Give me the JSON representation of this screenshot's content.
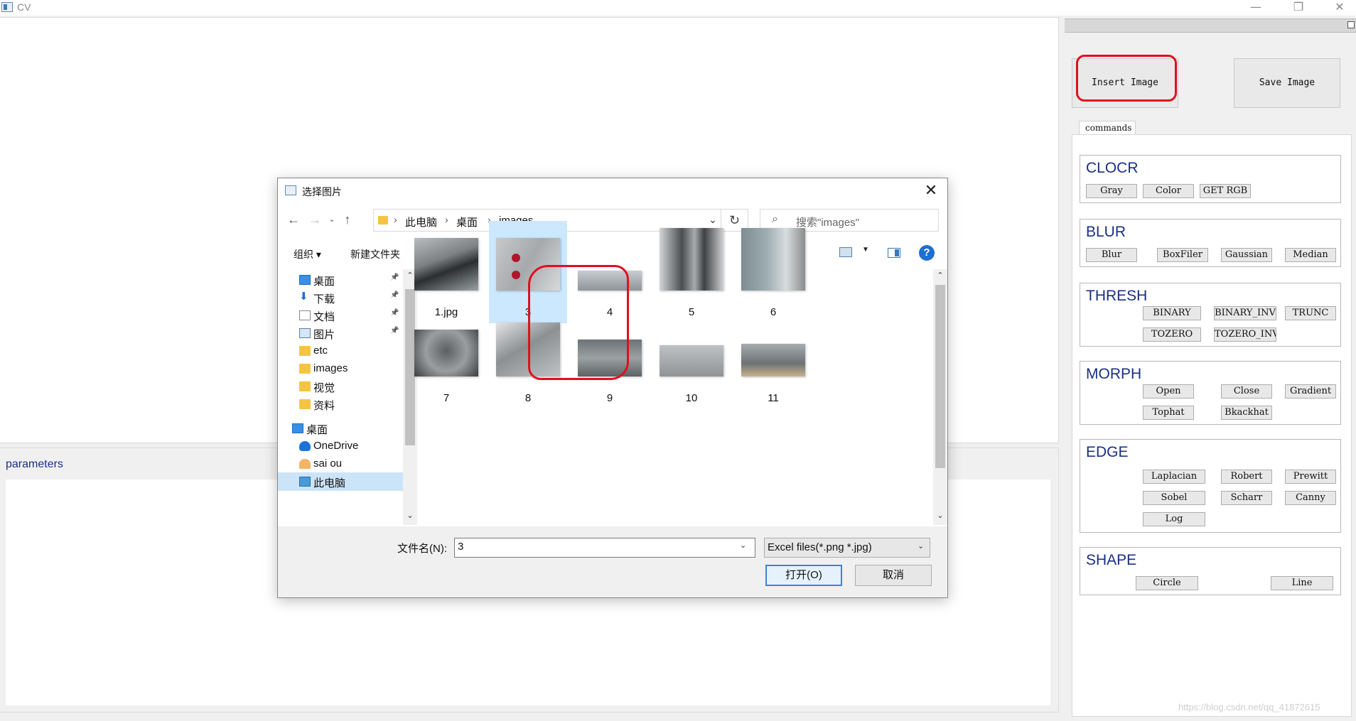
{
  "window": {
    "title": "CV",
    "controls": {
      "minimize": "—",
      "maximize": "❐",
      "close": "✕"
    }
  },
  "params_panel": {
    "title": "parameters"
  },
  "right_panel": {
    "insert_label": "Insert Image",
    "save_label": "Save Image",
    "commands_tab": "commands",
    "groups": [
      {
        "title": "CLOCR",
        "buttons": [
          "Gray",
          "Color",
          "GET RGB"
        ]
      },
      {
        "title": "BLUR",
        "buttons": [
          "Blur",
          "BoxFiler",
          "Gaussian",
          "Median"
        ]
      },
      {
        "title": "THRESH",
        "buttons": [
          "BINARY",
          "BINARY_INV",
          "TRUNC",
          "TOZERO",
          "TOZERO_INV"
        ]
      },
      {
        "title": "MORPH",
        "buttons": [
          "Open",
          "Close",
          "Gradient",
          "Tophat",
          "Bkackhat"
        ]
      },
      {
        "title": "EDGE",
        "buttons": [
          "Laplacian",
          "Robert",
          "Prewitt",
          "Sobel",
          "Scharr",
          "Canny",
          "Log"
        ]
      },
      {
        "title": "SHAPE",
        "buttons": [
          "Circle",
          "Line"
        ]
      }
    ]
  },
  "dialog": {
    "title": "选择图片",
    "breadcrumb": [
      "此电脑",
      "桌面",
      "images"
    ],
    "search_placeholder": "搜索\"images\"",
    "toolbar": {
      "organize": "组织 ▾",
      "new_folder": "新建文件夹"
    },
    "nav_items": [
      {
        "label": "桌面",
        "icon": "desktop-icon",
        "pinned": true
      },
      {
        "label": "下载",
        "icon": "download-icon",
        "pinned": true
      },
      {
        "label": "文档",
        "icon": "document-icon",
        "pinned": true
      },
      {
        "label": "图片",
        "icon": "pictures-icon",
        "pinned": true
      },
      {
        "label": "etc",
        "icon": "folder-icon",
        "pinned": false
      },
      {
        "label": "images",
        "icon": "folder-icon",
        "pinned": false
      },
      {
        "label": "视觉",
        "icon": "folder-icon",
        "pinned": false
      },
      {
        "label": "资料",
        "icon": "folder-icon",
        "pinned": false
      },
      {
        "label": "桌面",
        "icon": "desktop-icon",
        "pinned": false
      },
      {
        "label": "OneDrive",
        "icon": "onedrive-icon",
        "pinned": false
      },
      {
        "label": "sai ou",
        "icon": "user-icon",
        "pinned": false
      },
      {
        "label": "此电脑",
        "icon": "computer-icon",
        "pinned": false,
        "selected": true
      }
    ],
    "files": [
      "1.jpg",
      "3",
      "4",
      "5",
      "6",
      "7",
      "8",
      "9",
      "10",
      "11",
      ""
    ],
    "selected_file": "3",
    "filename_label": "文件名(N):",
    "filename_value": "3",
    "filetype_value": "Excel files(*.png *.jpg)",
    "open_label": "打开(O)",
    "cancel_label": "取消"
  },
  "watermark": "https://blog.csdn.net/qq_41872615"
}
